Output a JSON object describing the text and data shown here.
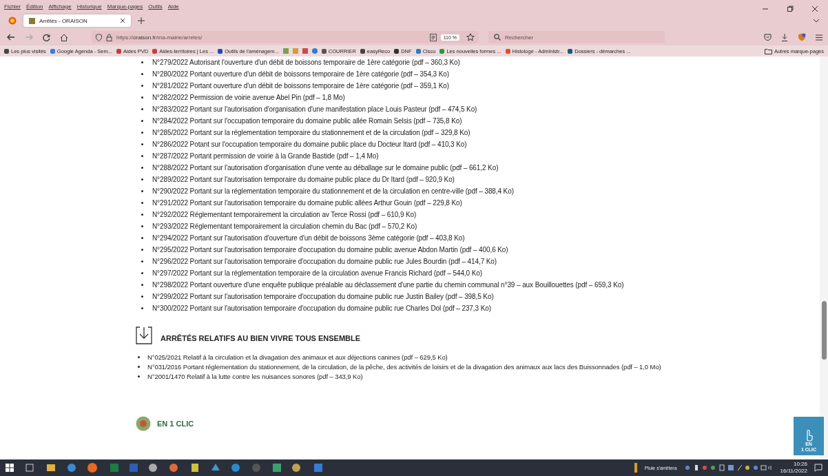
{
  "menu_bar": [
    "Fichier",
    "Édition",
    "Affichage",
    "Historique",
    "Marque-pages",
    "Outils",
    "Aide"
  ],
  "tabs": [
    {
      "title": "Arrêtés - ORAISON",
      "selected": true
    }
  ],
  "address": {
    "url_prefix": "https://",
    "url_host": "oraison.fr",
    "url_path": "/ma-mairie/arretes/"
  },
  "zoom": "110 %",
  "search": {
    "placeholder": "Rechercher"
  },
  "bookmarks": [
    "Les plus visités",
    "Google Agenda - Sem...",
    "Aides PVD",
    "Aides-territoires | Les ...",
    "Outils de l'aménagem...",
    "COURRIER",
    "easyReco",
    "DNF",
    "Cisco",
    "Les nouvelles formes ...",
    "Histologe - Administr...",
    "Dossiers - démarches ..."
  ],
  "other_bookmarks": "Autres marque-pages",
  "list_1": [
    "N°279/2022 Autorisant l'ouverture d'un débit de boissons temporaire de 1ère catégorie (pdf – 360,3 Ko)",
    "N°280/2022 Portant ouverture d'un débit de boissons temporaire de 1ère catégorie (pdf – 354,3 Ko)",
    "N°281/2022 Portant ouverture d'un débit de boissons temporaire de 1ère catégorie (pdf – 359,1 Ko)",
    "N°282/2022 Permission de voirie avenue Abel Pin (pdf – 1,8 Mo)",
    "N°283/2022 Portant sur l'autorisation d'organisation d'une manifestation place Louis Pasteur (pdf – 474,5 Ko)",
    "N°284/2022 Portant sur l'occupation temporaire du domaine public allée Romain Selsis (pdf – 735,8 Ko)",
    "N°285/2022 Portant sur la réglementation temporaire du stationnement et de la circulation (pdf – 329,8 Ko)",
    "N°286/2022 Potant sur l'occupation temporaire du domaine public place du Docteur Itard (pdf – 410,3 Ko)",
    "N°287/2022 Portant permission de voirie à la Grande Bastide (pdf – 1,4 Mo)",
    "N°288/2022 Portant sur l'autorisation d'organisation d'une vente au déballage sur le domaine public (pdf – 661,2 Ko)",
    "N°289/2022 Portant sur l'autorisation temporaire du domaine public place du Dr Itard (pdf – 920,9 Ko)",
    "N°290/2022 Portant sur la réglementation temporaire du stationnement et de la circulation en centre-ville (pdf – 388,4 Ko)",
    "N°291/2022 Portant sur l'autorisation temporaire du domaine public allées Arthur Gouin (pdf – 229,8 Ko)",
    "N°292/2022 Réglementant temporairement la circulation av Terce Rossi (pdf – 610,9 Ko)",
    "N°293/2022 Réglementant temporairement la circulation chemin du Bac (pdf – 570,2 Ko)",
    "N°294/2022 Portant sur l'autorisation d'ouverture d'un débit de boissons 3ème catégorie (pdf – 403,8 Ko)",
    "N°295/2022 Portant sur l'autorisation temporaire d'occupation du domaine public avenue Abdon Martin (pdf – 400,6 Ko)",
    "N°296/2022 Portant sur l'autorisation temporaire d'occupation du domaine public rue Jules Bourdin (pdf – 414,7 Ko)",
    "N°297/2022 Portant sur la réglementation temporaire de la circulation avenue Francis Richard (pdf – 544,0 Ko)",
    "N°298/2022 Portant ouverture d'une enquête publique préalable au déclassement d'une partie du chemin communal n°39 – aux Bouillouettes (pdf – 659,3 Ko)",
    "N°299/2022 Portant sur l'autorisation temporaire d'occupation du domaine public rue Justin Bailey (pdf – 398,5 Ko)",
    "N°300/2022 Portant sur l'autorisation temporaire d'occupation du domaine public rue Charles Dol (pdf – 237,3 Ko)"
  ],
  "section_heading": "ARRÊTÉS RELATIFS AU BIEN VIVRE TOUS ENSEMBLE",
  "list_2": [
    "N°025/2021 Relatif à la circulation et la divagation des animaux et aux déjections canines (pdf – 629,5 Ko)",
    "N°031/2016 Portant réglementation du stationnement, de la circulation, de la pêche, des activités de loisirs et de la divagation des animaux aux lacs des Buissonnades (pdf – 1,0 Mo)",
    "N°2001/1470 Relatif à la lutte contre les nuisances sonores (pdf – 343,9 Ko)"
  ],
  "footer_heading": "EN 1 CLIC",
  "float_button": [
    "EN",
    "1 CLIC"
  ],
  "taskbar": {
    "weather": "Pluie s'arrêtera",
    "time": "10:26",
    "date": "16/11/2022"
  }
}
